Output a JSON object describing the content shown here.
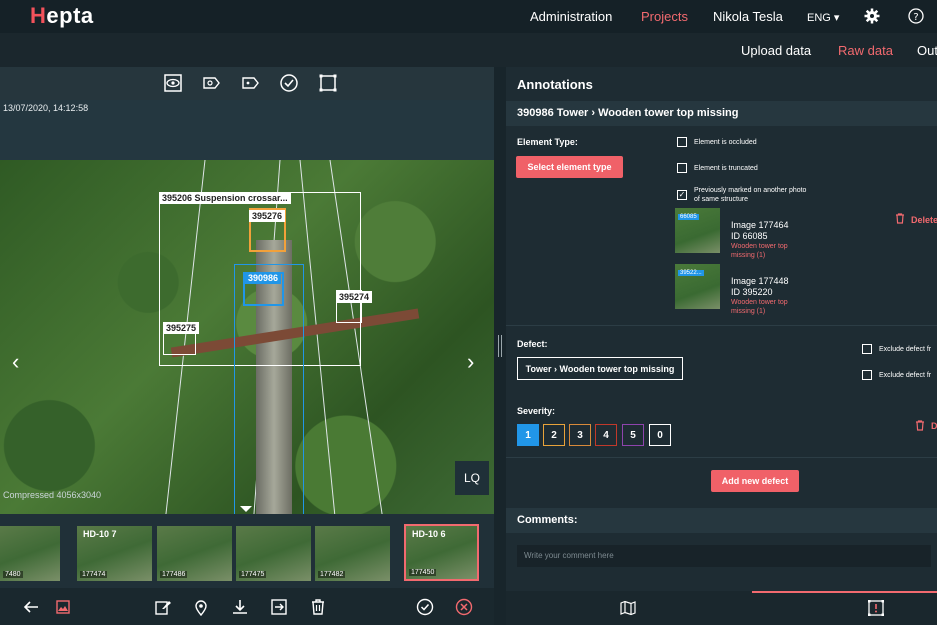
{
  "header": {
    "logo": "Hepta",
    "logo_mark": "H",
    "logo_rest": "epta",
    "nav": [
      "Administration",
      "Projects",
      "Nikola Tesla",
      "ENG"
    ],
    "active": "Projects"
  },
  "subnav": {
    "items": [
      "Upload data",
      "Raw data",
      "Out"
    ],
    "active": "Raw data"
  },
  "viewer": {
    "timestamp": "13/07/2020, 14:12:58",
    "compressed": "Compressed 4056x3040",
    "lq_label": "LQ",
    "boxes": [
      {
        "label": "395206 Suspension crossar..."
      },
      {
        "label": "395276"
      },
      {
        "label": "390986"
      },
      {
        "label": "395274"
      },
      {
        "label": "395275"
      }
    ],
    "thumbnails": [
      {
        "title": "",
        "id": "7480"
      },
      {
        "title": "HD-10 7",
        "id": "177474"
      },
      {
        "title": "",
        "id": "177486"
      },
      {
        "title": "",
        "id": "177475"
      },
      {
        "title": "",
        "id": "177482"
      },
      {
        "title": "HD-10 6",
        "id": "177450"
      }
    ]
  },
  "panel": {
    "title": "Annotations",
    "breadcrumb": "390986 Tower › Wooden tower top missing",
    "element_type_label": "Element Type:",
    "select_btn": "Select element type",
    "checkboxes": [
      "Element is occluded",
      "Element is truncated",
      "Previously marked on another photo of same structure"
    ],
    "delete_label": "Delete",
    "related": [
      {
        "image": "Image 177464",
        "id": "ID 66085",
        "defect": "Wooden tower top missing (1)",
        "tag": "66085"
      },
      {
        "image": "Image 177448",
        "id": "ID 395220",
        "defect": "Wooden tower top missing (1)",
        "tag": "39522..."
      }
    ],
    "defect_label": "Defect:",
    "defect_value": "Tower › Wooden tower top missing",
    "exclude": [
      "Exclude defect fr",
      "Exclude defect fr"
    ],
    "severity_label": "Severity:",
    "severity": [
      {
        "v": "1",
        "color": "#2196e8"
      },
      {
        "v": "2",
        "color": "#e8a33a"
      },
      {
        "v": "3",
        "color": "#d98a3a"
      },
      {
        "v": "4",
        "color": "#c0392b"
      },
      {
        "v": "5",
        "color": "#8e44ad"
      },
      {
        "v": "0",
        "color": "#ffffff"
      }
    ],
    "d_label": "D",
    "add_defect": "Add new defect",
    "comments_label": "Comments:",
    "comment_placeholder": "Write your comment here"
  }
}
